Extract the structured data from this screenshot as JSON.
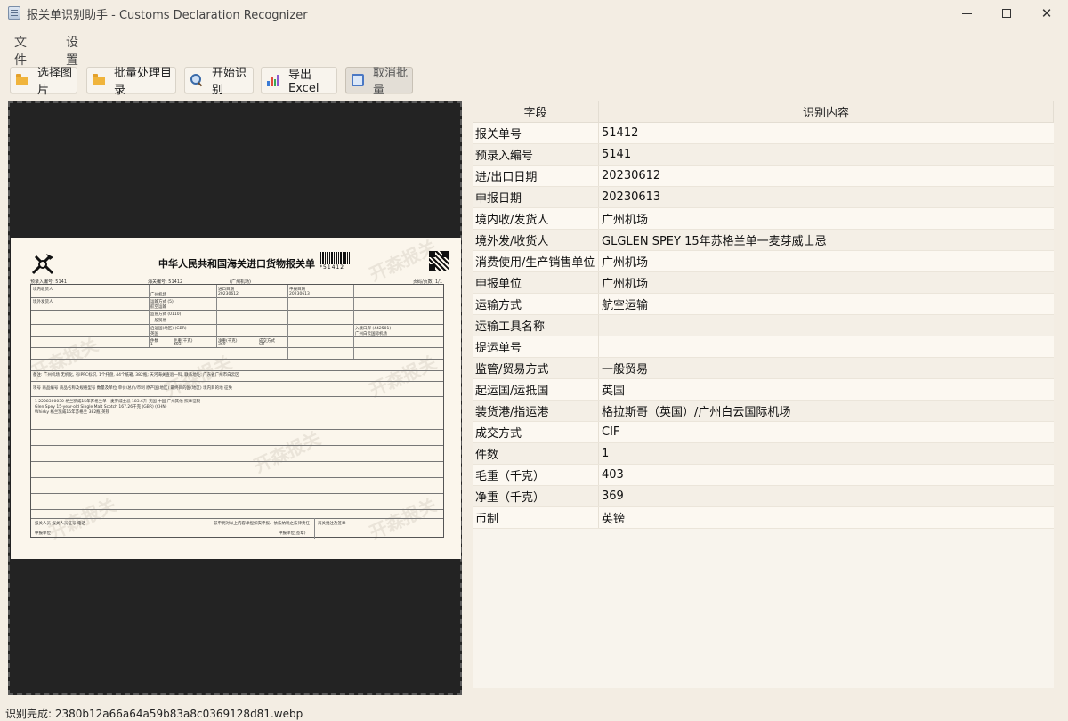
{
  "window": {
    "title": "报关单识别助手 - Customs Declaration Recognizer",
    "minimize_icon": "minimize-icon",
    "maximize_icon": "maximize-icon",
    "close_icon": "close-icon",
    "close_glyph": "✕"
  },
  "menu": {
    "file": "文件",
    "settings": "设置"
  },
  "toolbar": {
    "select_image": "选择图片",
    "batch_dir": "批量处理目录",
    "start_recognize": "开始识别",
    "export_excel": "导出 Excel",
    "cancel_batch": "取消批量"
  },
  "colors": {
    "background": "#f3ede3",
    "image_panel": "#232323",
    "folder_icon": "#f0b43c"
  },
  "document": {
    "title": "中华人民共和国海关进口货物报关单",
    "barcode_number": "*51412",
    "watermark": "开森报关",
    "meta_left": "预录入编号: 5141",
    "meta_mid": "海关编号: 51412",
    "meta_mid2": "(广州机场)",
    "meta_right": "页码/页数: 1/1",
    "consignee_label": "境内收货人",
    "consignee_value": "广州机场",
    "declare_date_label": "申报日期",
    "declare_date_value": "20230613",
    "import_date_label": "进口日期",
    "import_date_value": "20230612",
    "shipper_label": "境外发货人",
    "transport_label": "运输方式 (5)",
    "transport_value": "航空运输",
    "supervision_label": "监管方式 (0110)",
    "supervision_value": "一般贸易",
    "origin_label": "启运国(地区) (GBR)",
    "origin_value": "英国",
    "port_label": "入境口岸 (442501)",
    "port_value": "广州白云国际机场",
    "packages_label": "件数",
    "packages_value": "1",
    "gross_label": "毛重(千克)",
    "gross_value": "403",
    "net_label": "净重(千克)",
    "net_value": "369",
    "terms_label": "成交方式",
    "terms_value": "CIF",
    "goods_header": "项号  商品编号  商品名称及规格型号  数量及单位  单价/总价/币制  原产国(地区)  最终目的国(地区)  境内目的地  征免",
    "goods_line1": "1 2208300030 格兰凯威15年苏格兰单一麦芽威士忌   183.6升   英国   中国   广州其他   照章征税",
    "goods_line2": "Glen Spey 15-year-old Single Malt Scotch   167.26千克   (GBR)   (CHN)",
    "goods_line3": "Whisky 格兰凯威15年苏格兰   382瓶   英镑",
    "remark": "备注: 广州机场 无机化, 有IPPC标识, 1个托盘, 44个纸箱, 382瓶; 天河海关查验一科, 联系地址: 广东省广州市白云区",
    "footer_left": "报关人员   报关人员证号   电话",
    "footer_mid": "兹申明对以上内容承担如实申报、依法纳税之法律责任",
    "footer_right": "海关批注及签章",
    "footer_unit": "申报单位",
    "footer_stamp": "申报单位(签章)"
  },
  "table": {
    "headers": [
      "字段",
      "识别内容"
    ],
    "rows": [
      [
        "报关单号",
        "51412"
      ],
      [
        "预录入编号",
        "5141"
      ],
      [
        "进/出口日期",
        "20230612"
      ],
      [
        "申报日期",
        "20230613"
      ],
      [
        "境内收/发货人",
        "广州机场"
      ],
      [
        "境外发/收货人",
        "GLGLEN SPEY 15年苏格兰单一麦芽威士忌"
      ],
      [
        "消费使用/生产销售单位",
        "广州机场"
      ],
      [
        "申报单位",
        "广州机场"
      ],
      [
        "运输方式",
        "航空运输"
      ],
      [
        "运输工具名称",
        ""
      ],
      [
        "提运单号",
        ""
      ],
      [
        "监管/贸易方式",
        "一般贸易"
      ],
      [
        "起运国/运抵国",
        "英国"
      ],
      [
        "装货港/指运港",
        "格拉斯哥（英国）/广州白云国际机场"
      ],
      [
        "成交方式",
        "CIF"
      ],
      [
        "件数",
        "1"
      ],
      [
        "毛重（千克）",
        "403"
      ],
      [
        "净重（千克）",
        "369"
      ],
      [
        "币制",
        "英镑"
      ]
    ]
  },
  "status": {
    "text": "识别完成: 2380b12a66a64a59b83a8c0369128d81.webp"
  }
}
